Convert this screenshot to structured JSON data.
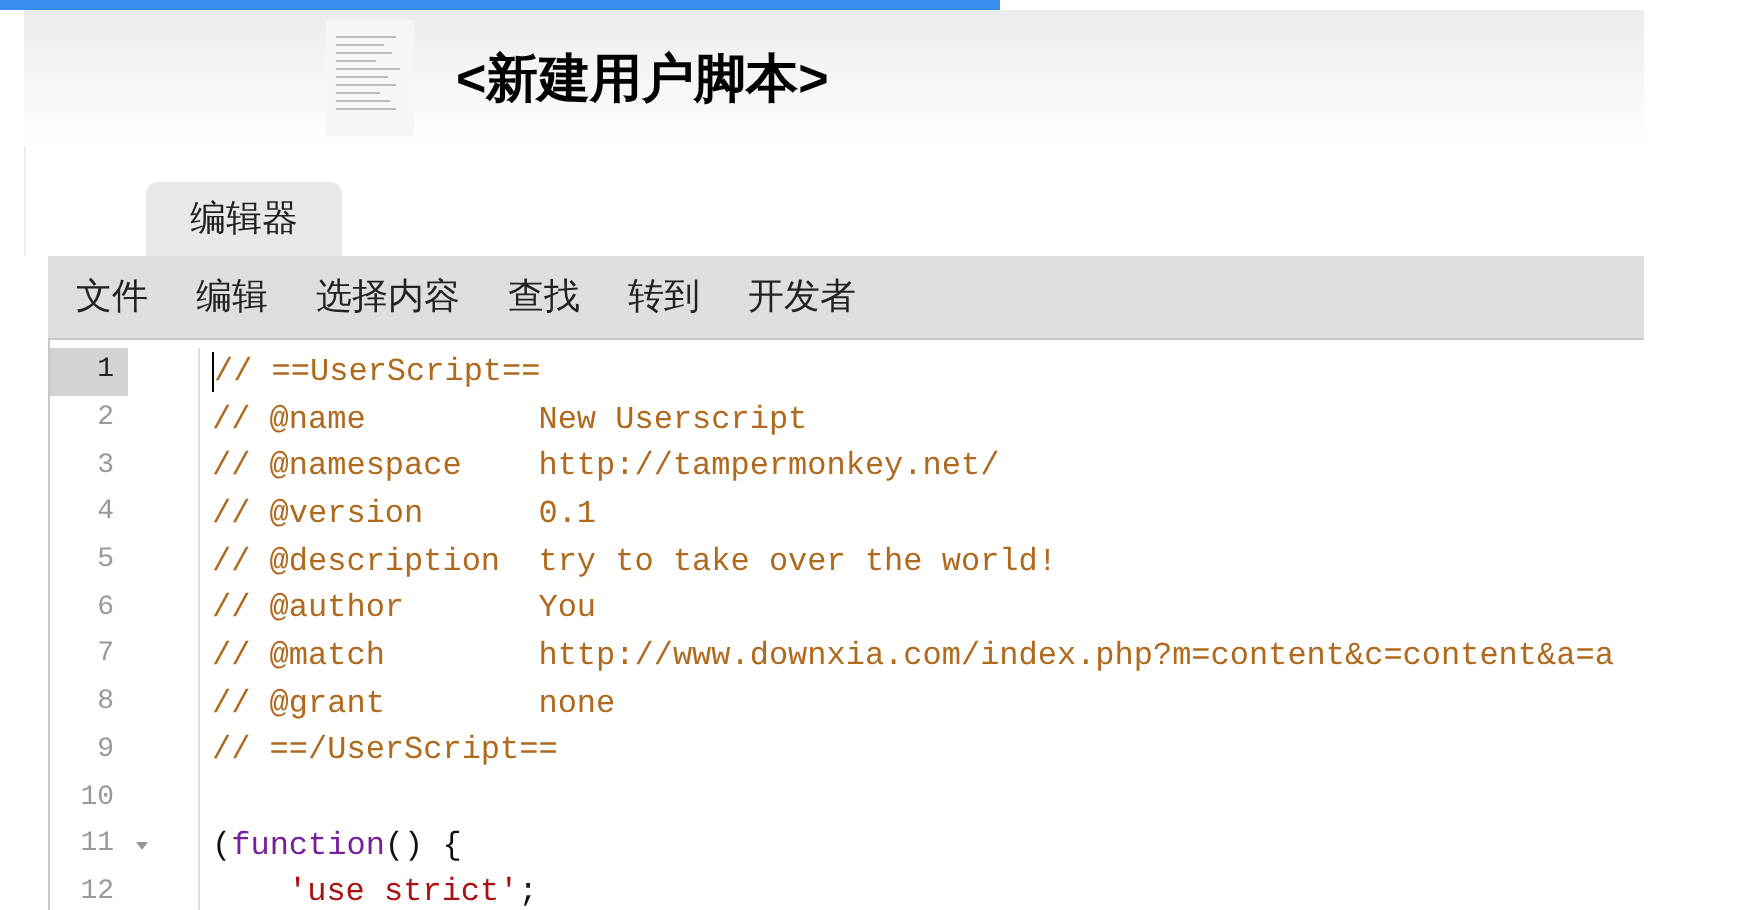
{
  "progress": {
    "level": 0.571
  },
  "header": {
    "title": "<新建用户脚本>"
  },
  "tabs": [
    {
      "label": "编辑器",
      "selected": true
    }
  ],
  "menu": [
    {
      "label": "文件"
    },
    {
      "label": "编辑"
    },
    {
      "label": "选择内容"
    },
    {
      "label": "查找"
    },
    {
      "label": "转到"
    },
    {
      "label": "开发者"
    }
  ],
  "editor": {
    "lines": [
      {
        "number": "1",
        "selected": true,
        "foldable": false,
        "tokens": [
          {
            "kind": "comment",
            "text": "// ==UserScript=="
          }
        ]
      },
      {
        "number": "2",
        "selected": false,
        "foldable": false,
        "tokens": [
          {
            "kind": "comment",
            "text": "// @name         New Userscript"
          }
        ]
      },
      {
        "number": "3",
        "selected": false,
        "foldable": false,
        "tokens": [
          {
            "kind": "comment",
            "text": "// @namespace    http://tampermonkey.net/"
          }
        ]
      },
      {
        "number": "4",
        "selected": false,
        "foldable": false,
        "tokens": [
          {
            "kind": "comment",
            "text": "// @version      0.1"
          }
        ]
      },
      {
        "number": "5",
        "selected": false,
        "foldable": false,
        "tokens": [
          {
            "kind": "comment",
            "text": "// @description  try to take over the world!"
          }
        ]
      },
      {
        "number": "6",
        "selected": false,
        "foldable": false,
        "tokens": [
          {
            "kind": "comment",
            "text": "// @author       You"
          }
        ]
      },
      {
        "number": "7",
        "selected": false,
        "foldable": false,
        "tokens": [
          {
            "kind": "comment",
            "text": "// @match        http://www.downxia.com/index.php?m=content&c=content&a=a"
          }
        ]
      },
      {
        "number": "8",
        "selected": false,
        "foldable": false,
        "tokens": [
          {
            "kind": "comment",
            "text": "// @grant        none"
          }
        ]
      },
      {
        "number": "9",
        "selected": false,
        "foldable": false,
        "tokens": [
          {
            "kind": "comment",
            "text": "// ==/UserScript=="
          }
        ]
      },
      {
        "number": "10",
        "selected": false,
        "foldable": false
      },
      {
        "number": "11",
        "selected": false,
        "foldable": true,
        "tokens": [
          {
            "kind": "plain",
            "text": "("
          },
          {
            "kind": "keyword",
            "text": "function"
          },
          {
            "kind": "plain",
            "text": "() {"
          }
        ]
      },
      {
        "number": "12",
        "selected": false,
        "foldable": false,
        "indented": true,
        "tokens": [
          {
            "kind": "string",
            "text": "'use strict'"
          },
          {
            "kind": "plain",
            "text": ";"
          }
        ]
      }
    ]
  }
}
